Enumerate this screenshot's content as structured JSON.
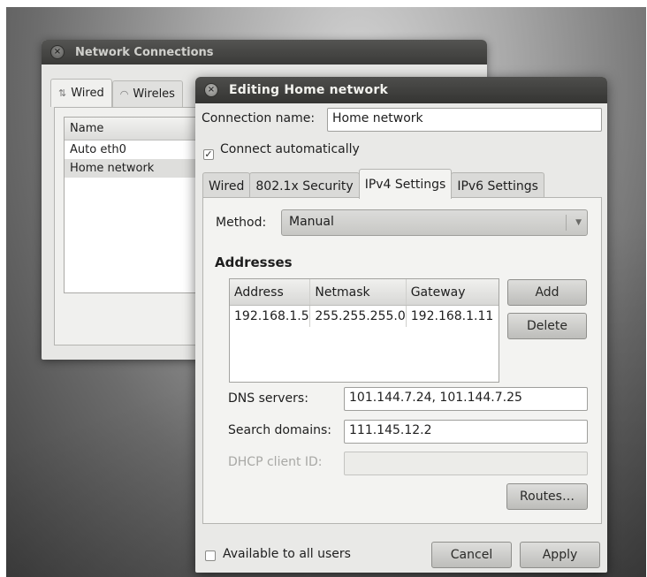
{
  "back_window": {
    "title": "Network Connections",
    "tabs": [
      {
        "label": "Wired",
        "icon": "wired-icon"
      },
      {
        "label": "Wireles",
        "icon": "wireless-icon"
      }
    ],
    "list": {
      "header": "Name",
      "rows": [
        "Auto eth0",
        "Home network"
      ]
    }
  },
  "dialog": {
    "title": "Editing Home network",
    "connection_name_label": "Connection name:",
    "connection_name_value": "Home network",
    "connect_auto_label": "Connect automatically",
    "connect_auto_checked": true,
    "tabs": [
      "Wired",
      "802.1x Security",
      "IPv4 Settings",
      "IPv6 Settings"
    ],
    "active_tab": "IPv4 Settings",
    "method_label": "Method:",
    "method_value": "Manual",
    "addresses_title": "Addresses",
    "address_columns": [
      "Address",
      "Netmask",
      "Gateway"
    ],
    "address_rows": [
      [
        "192.168.1.5",
        "255.255.255.0",
        "192.168.1.11"
      ]
    ],
    "add_button": "Add",
    "delete_button": "Delete",
    "dns_label": "DNS servers:",
    "dns_value": "101.144.7.24, 101.144.7.25",
    "search_domains_label": "Search domains:",
    "search_domains_value": "111.145.12.2",
    "dhcp_label": "DHCP client ID:",
    "dhcp_value": "",
    "routes_button": "Routes…",
    "available_all_users_label": "Available to all users",
    "available_all_users_checked": false,
    "cancel_button": "Cancel",
    "apply_button": "Apply"
  },
  "colors": {
    "titlebar": "#3f3f3d",
    "window_bg": "#e9e9e7",
    "panel_bg": "#f3f3f1"
  }
}
